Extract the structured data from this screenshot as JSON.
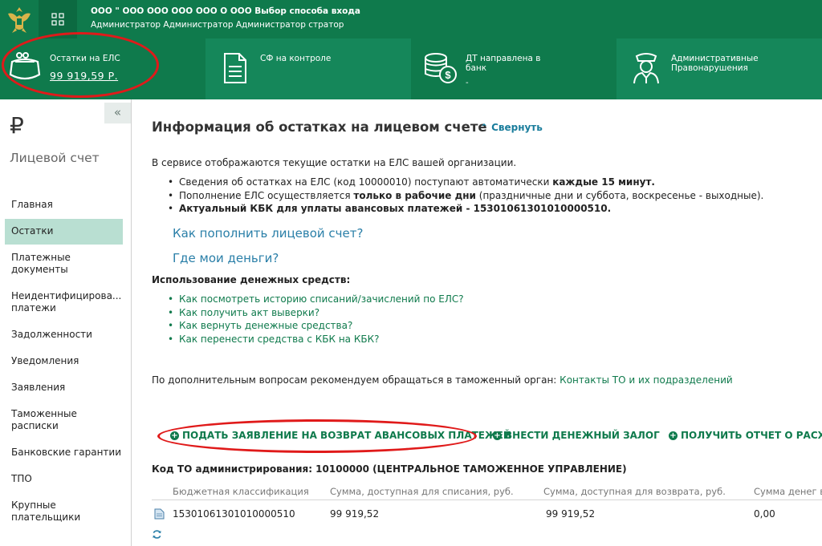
{
  "header": {
    "org_line": "ООО \" ООО  ООО  ООО  ООО  О ООО   Выбор способа входа",
    "role_line": "Администратор Администратор Администратор  стратор"
  },
  "tiles": [
    {
      "label": "Остатки на ЕЛС",
      "value": "99 919,59 Р."
    },
    {
      "label": "СФ на контроле"
    },
    {
      "label": "ДТ направлена в банк",
      "sub": "-"
    },
    {
      "label": "Административные Правонарушения"
    }
  ],
  "sidebar": {
    "collapse": "«",
    "currency_symbol": "₽",
    "title": "Лицевой счет",
    "items": [
      {
        "label": "Главная"
      },
      {
        "label": "Остатки"
      },
      {
        "label": "Платежные документы"
      },
      {
        "label": "Неидентифицирова... платежи"
      },
      {
        "label": "Задолженности"
      },
      {
        "label": "Уведомления"
      },
      {
        "label": "Заявления"
      },
      {
        "label": "Таможенные расписки"
      },
      {
        "label": "Банковские гарантии"
      },
      {
        "label": "ТПО"
      },
      {
        "label": "Крупные плательщики"
      }
    ]
  },
  "main": {
    "title": "Информация об остатках на лицевом счете",
    "collapse_link": "Свернуть",
    "intro": "В сервисе отображаются текущие остатки на ЕЛС вашей организации.",
    "bullet1_pre": "Сведения об остатках на ЕЛС (код 10000010) поступают автоматически ",
    "bullet1_bold": "каждые 15 минут.",
    "bullet2_pre": "Пополнение ЕЛС осуществляется ",
    "bullet2_bold": "только в рабочие дни",
    "bullet2_post": " (праздничные дни и суббота, воскресенье - выходные).",
    "bullet3": "Актуальный КБК для уплаты авансовых платежей - 15301061301010000510.",
    "link_topup": "Как пополнить лицевой счет?",
    "link_money": "Где мои деньги?",
    "usage_title": "Использование денежных средств:",
    "usage_links": [
      "Как посмотреть историю списаний/зачислений по ЕЛС?",
      "Как получить акт выверки?",
      "Как вернуть денежные средства?",
      "Как перенести средства с КБК на КБК?"
    ],
    "contacts_text": "По дополнительным вопросам рекомендуем обращаться в таможенный орган: ",
    "contacts_link": "Контакты ТО и их подразделений",
    "buttons": {
      "refund": "ПОДАТЬ ЗАЯВЛЕНИЕ НА ВОЗВРАТ АВАНСОВЫХ ПЛАТЕЖЕЙ",
      "deposit": "ВНЕСТИ ДЕНЕЖНЫЙ ЗАЛОГ",
      "report": "ПОЛУЧИТЬ ОТЧЕТ О РАСХОДО"
    },
    "admin_code": "Код ТО администрирования: 10100000 (ЦЕНТРАЛЬНОЕ ТАМОЖЕННОЕ УПРАВЛЕНИЕ)",
    "table": {
      "headers": [
        "Бюджетная классификация",
        "Сумма, доступная для списания, руб.",
        "Сумма, доступная для возврата, руб.",
        "Сумма денег в"
      ],
      "rows": [
        [
          "15301061301010000510",
          "99 919,52",
          "99 919,52",
          "0,00"
        ]
      ]
    }
  },
  "colors": {
    "brand_green": "#0f7a4c",
    "active_item": "#b9dfd2",
    "annotation_red": "#e01a1a",
    "link_blue": "#2a7fa8"
  }
}
